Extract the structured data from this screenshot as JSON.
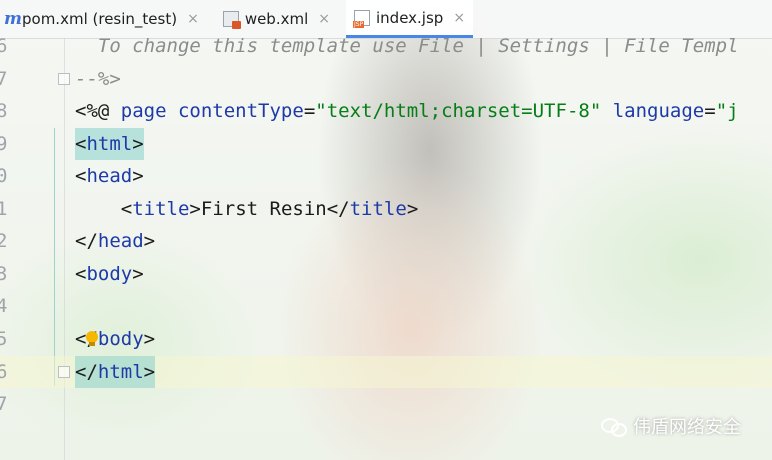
{
  "tabs": [
    {
      "label": "pom.xml (resin_test)",
      "icon": "maven-icon",
      "active": false
    },
    {
      "label": "web.xml",
      "icon": "xml-file-icon",
      "active": false
    },
    {
      "label": "index.jsp",
      "icon": "jsp-file-icon",
      "active": true
    }
  ],
  "close_glyph": "×",
  "editor": {
    "line_numbers": [
      "6",
      "7",
      "8",
      "9",
      "0",
      "1",
      "2",
      "3",
      "4",
      "5",
      "6",
      "7"
    ],
    "line6": "  To change this template use File | Settings | File Templ",
    "line7": "--%>",
    "line8": {
      "open": "<%@ ",
      "kw1": "page",
      "sp1": " ",
      "attr1": "contentType",
      "eq1": "=",
      "val1": "\"text/html;charset=UTF-8\"",
      "sp2": " ",
      "attr2": "language",
      "eq2": "=",
      "val2": "\"j"
    },
    "line9": {
      "lt": "<",
      "tag": "html",
      "gt": ">"
    },
    "line10": {
      "lt": "<",
      "tag": "head",
      "gt": ">"
    },
    "line11": {
      "indent": "    ",
      "lt1": "<",
      "tag1": "title",
      "gt1": ">",
      "text": "First Resin",
      "lt2": "</",
      "tag2": "title",
      "gt2": ">"
    },
    "line12": {
      "lt": "</",
      "tag": "head",
      "gt": ">"
    },
    "line13": {
      "lt": "<",
      "tag": "body",
      "gt": ">"
    },
    "line15": {
      "lt": "</",
      "tag": "body",
      "gt": ">"
    },
    "line16": {
      "lt": "</",
      "tag": "html",
      "gt": ">"
    }
  },
  "watermark": {
    "text": "伟盾网络安全",
    "icon": "wechat-icon"
  },
  "colors": {
    "keyword": "#1d3aa8",
    "string": "#067d17",
    "comment": "#8c8c8c",
    "active_tab_underline": "#4a86e8",
    "matched_tag_bg": "#96d6d0"
  }
}
